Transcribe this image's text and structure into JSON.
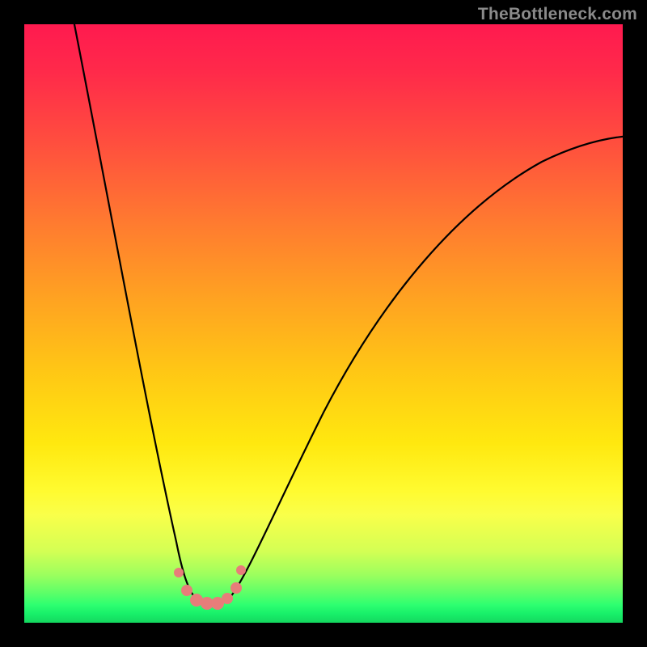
{
  "watermark": "TheBottleneck.com",
  "colors": {
    "frame": "#000000",
    "top": "#ff1a4f",
    "mid": "#ffe80f",
    "bottom": "#14d75f",
    "dot": "#e77d7a",
    "watermark_text": "#8a8a8a"
  },
  "chart_data": {
    "type": "line",
    "title": "",
    "xlabel": "",
    "ylabel": "",
    "x_range_relative": [
      0,
      100
    ],
    "y_range_relative": [
      0,
      100
    ],
    "note": "Axes are unlabeled; values are relative percentages of the plot area. y=0 is the bottom (green / no bottleneck), y=100 is the top (red / severe bottleneck). The curve forms a V with its minimum near x≈28.",
    "series": [
      {
        "name": "bottleneck-curve",
        "x": [
          8,
          12,
          16,
          20,
          24,
          26,
          28,
          30,
          32,
          36,
          42,
          50,
          60,
          72,
          86,
          100
        ],
        "y": [
          100,
          80,
          59,
          38,
          17,
          7,
          3,
          3,
          7,
          18,
          33,
          48,
          62,
          73,
          79,
          81
        ]
      }
    ],
    "highlight_points": {
      "name": "valley-dots",
      "x": [
        25.8,
        27.2,
        28.8,
        30.5,
        32.3,
        33.9,
        35.4,
        36.2
      ],
      "y": [
        8.4,
        5.4,
        3.8,
        3.2,
        3.2,
        4.1,
        5.8,
        8.8
      ]
    },
    "background_gradient": "vertical red→yellow→green (risk heatmap)"
  }
}
